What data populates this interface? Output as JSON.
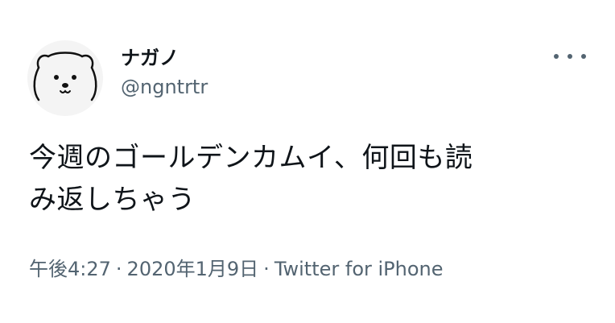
{
  "user": {
    "display_name": "ナガノ",
    "handle": "@ngntrtr",
    "avatar": "bear-face-icon"
  },
  "actions": {
    "more_icon": "more-dots-icon"
  },
  "tweet": {
    "line1": "今週のゴールデンカムイ、何回も読",
    "line2": "み返しちゃう"
  },
  "meta": {
    "time": "午後4:27",
    "separator": "·",
    "date": "2020年1月9日",
    "source": "Twitter for iPhone"
  },
  "colors": {
    "text": "#0f1419",
    "secondary": "#536471",
    "avatar_bg": "#f4f4f4"
  }
}
